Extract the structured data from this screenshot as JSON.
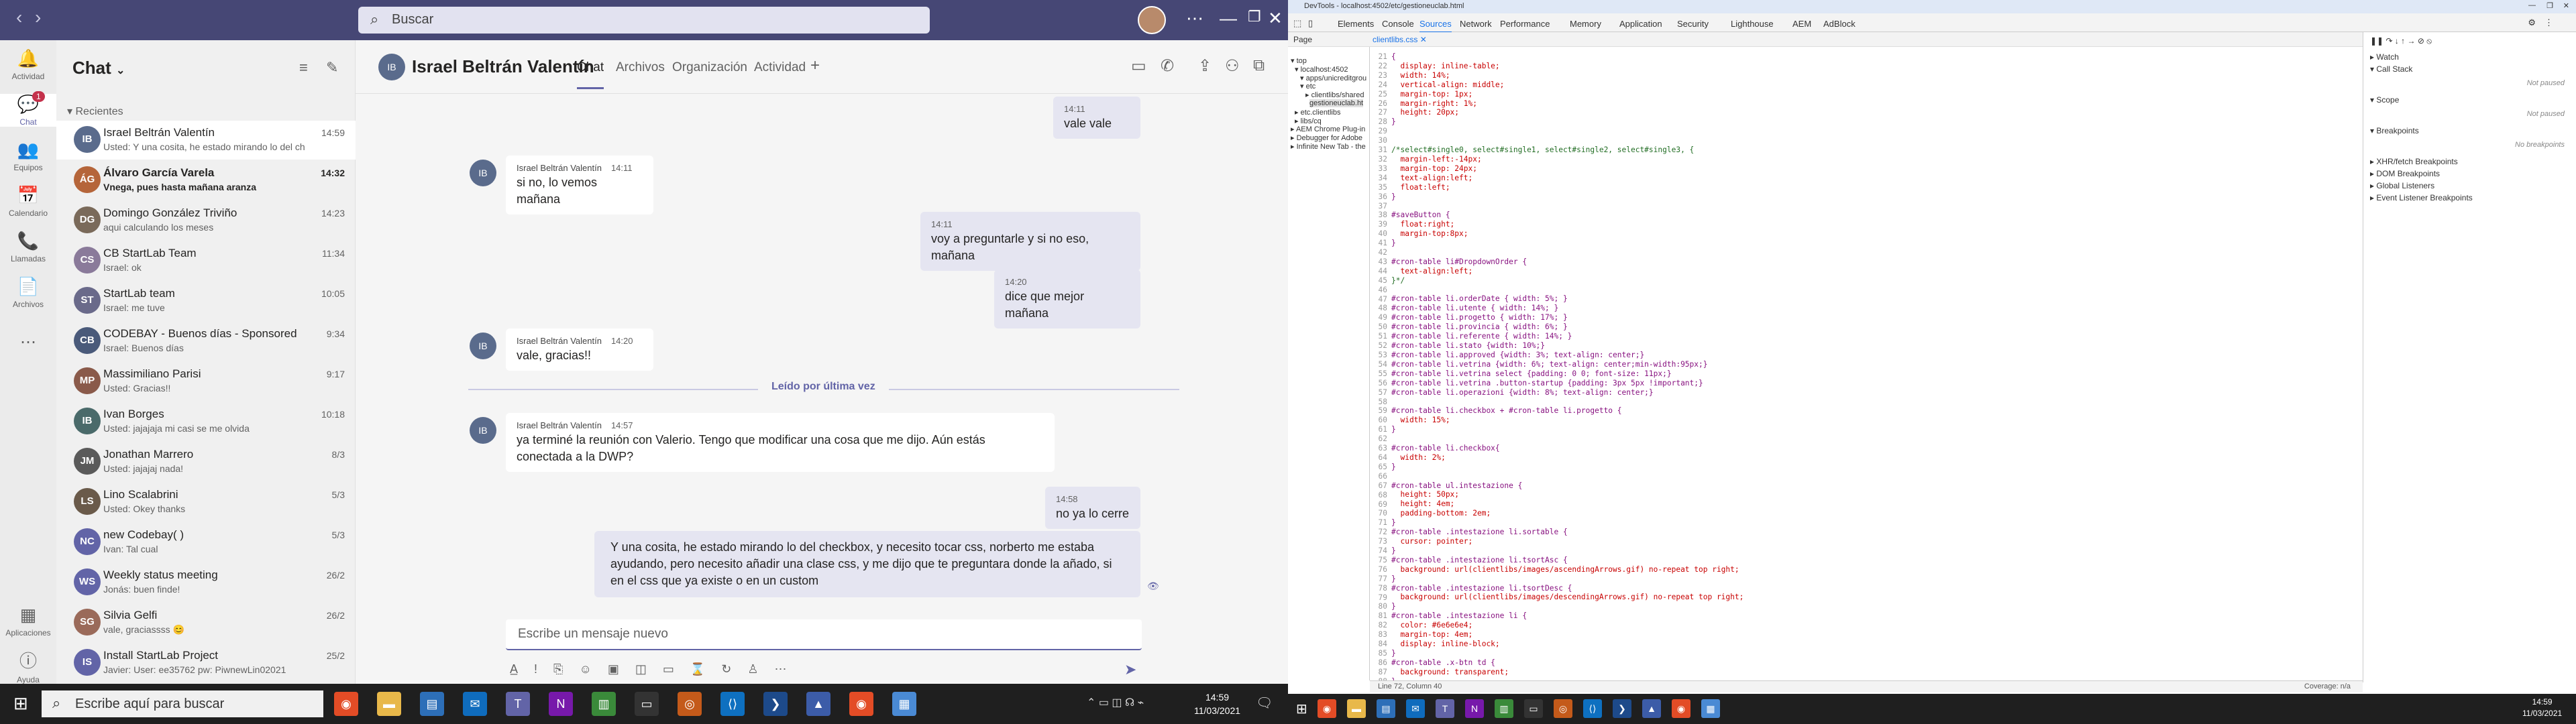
{
  "teams": {
    "search_placeholder": "Buscar",
    "rail": [
      {
        "label": "Actividad",
        "icon": "bell-icon"
      },
      {
        "label": "Chat",
        "icon": "chat-icon",
        "badge": "1"
      },
      {
        "label": "Equipos",
        "icon": "teams-icon"
      },
      {
        "label": "Calendario",
        "icon": "calendar-icon"
      },
      {
        "label": "Llamadas",
        "icon": "phone-icon"
      },
      {
        "label": "Archivos",
        "icon": "file-icon"
      },
      {
        "label": "Aplicaciones",
        "icon": "apps-icon"
      },
      {
        "label": "Ayuda",
        "icon": "help-icon"
      }
    ],
    "list_title": "Chat",
    "recent_label": "Recientes",
    "chats": [
      {
        "name": "Israel Beltrán Valentín",
        "preview": "Usted: Y una cosita, he estado mirando lo del ch...",
        "time": "14:59",
        "initials": "IB",
        "color": "#5a6b8c"
      },
      {
        "name": "Álvaro García Varela",
        "preview": "Vnega, pues hasta mañana aranza",
        "time": "14:32",
        "initials": "ÁG",
        "color": "#b5653a"
      },
      {
        "name": "Domingo González Triviño",
        "preview": "aqui calculando los meses",
        "time": "14:23",
        "initials": "DG",
        "color": "#7a6a5a"
      },
      {
        "name": "CB StartLab Team",
        "preview": "Israel: ok",
        "time": "11:34",
        "initials": "CS",
        "color": "#8a7a9a"
      },
      {
        "name": "StartLab team",
        "preview": "Israel: me tuve",
        "time": "10:05",
        "initials": "ST",
        "color": "#6a6a8a"
      },
      {
        "name": "CODEBAY - Buenos días - Sponsored by...",
        "preview": "Israel: Buenos días",
        "time": "9:34",
        "initials": "CB",
        "color": "#4a5a7a"
      },
      {
        "name": "Massimiliano Parisi",
        "preview": "Usted: Gracias!!",
        "time": "9:17",
        "initials": "MP",
        "color": "#8a5a4a"
      },
      {
        "name": "Ivan Borges",
        "preview": "Usted: jajajaja mi casi se me olvida",
        "time": "10:18",
        "initials": "IB",
        "color": "#4a6a6a"
      },
      {
        "name": "Jonathan Marrero",
        "preview": "Usted: jajajaj nada!",
        "time": "8/3",
        "initials": "JM",
        "color": "#5a5a5a"
      },
      {
        "name": "Lino Scalabrini",
        "preview": "Usted: Okey thanks",
        "time": "5/3",
        "initials": "LS",
        "color": "#6a5a4a"
      },
      {
        "name": "new Codebay( )",
        "preview": "Ivan: Tal cual",
        "time": "5/3",
        "initials": "NC",
        "color": "#6264a7"
      },
      {
        "name": "Weekly status meeting",
        "preview": "Jonás: buen finde!",
        "time": "26/2",
        "initials": "WS",
        "color": "#6264a7"
      },
      {
        "name": "Silvia Gelfi",
        "preview": "vale, graciassss 😊",
        "time": "26/2",
        "initials": "SG",
        "color": "#9a6a5a"
      },
      {
        "name": "Install StartLab Project",
        "preview": "Javier: User: ee35762 pw: PiwnewLin02021",
        "time": "25/2",
        "initials": "IS",
        "color": "#6264a7"
      }
    ],
    "conversation": {
      "name": "Israel Beltrán Valentín",
      "tabs": [
        "Chat",
        "Archivos",
        "Organización",
        "Actividad"
      ],
      "add_tab": "+",
      "read_label": "Leído por última vez",
      "compose_placeholder": "Escribe un mensaje nuevo",
      "messages": [
        {
          "who": "me",
          "time": "14:11",
          "text": "vale vale"
        },
        {
          "who": "them",
          "author": "Israel Beltrán Valentín",
          "time": "14:11",
          "text": "si no, lo vemos mañana"
        },
        {
          "who": "me",
          "time": "14:11",
          "text": "voy a preguntarle y si no eso, mañana"
        },
        {
          "who": "me",
          "time": "14:20",
          "text": "dice que mejor mañana"
        },
        {
          "who": "them",
          "author": "Israel Beltrán Valentín",
          "time": "14:20",
          "text": "vale, gracias!!"
        },
        {
          "who": "them",
          "author": "Israel Beltrán Valentín",
          "time": "14:57",
          "text": "ya terminé la reunión con Valerio. Tengo que modificar una cosa que me dijo. Aún estás conectada a la DWP?"
        },
        {
          "who": "me",
          "time": "14:58",
          "text": "no ya lo cerre"
        },
        {
          "who": "me",
          "time": "",
          "text": "Y una cosita, he estado mirando lo del checkbox, y necesito tocar css, norberto me estaba ayudando, pero necesito añadir una clase css, y me dijo que te preguntara donde la añado, si en el css que ya existe o en un custom"
        }
      ]
    },
    "taskbar": {
      "search": "Escribe aquí para buscar",
      "time": "14:59",
      "date": "11/03/2021"
    }
  },
  "devtools": {
    "title": "DevTools - localhost:4502/etc/gestioneuclab.html",
    "tabs": [
      "Elements",
      "Console",
      "Sources",
      "Network",
      "Performance",
      "Memory",
      "Application",
      "Security",
      "Lighthouse",
      "AEM",
      "AdBlock"
    ],
    "active_tab": "Sources",
    "sub_page": "Page",
    "file_tab": "clientlibs.css",
    "tree": [
      "▾ top",
      "▾ localhost:4502",
      "▾ apps/unicreditgrou",
      "▾ etc",
      "▸ clientlibs/shared",
      "gestioneuclab.ht",
      "▸ etc.clientlibs",
      "▸ libs/cq",
      "▸ AEM Chrome Plug-in",
      "▸ Debugger for Adobe",
      "▸ Infinite New Tab - the"
    ],
    "line_start": 21,
    "code_lines": [
      "{",
      "  display: inline-table;",
      "  width: 14%;",
      "  vertical-align: middle;",
      "  margin-top: 1px;",
      "  margin-right: 1%;",
      "  height: 20px;",
      "}",
      "",
      "",
      "/*select#single0, select#single1, select#single2, select#single3, {",
      "  margin-left:-14px;",
      "  margin-top: 24px;",
      "  text-align:left;",
      "  float:left;",
      "}",
      "",
      "#saveButton {",
      "  float:right;",
      "  margin-top:8px;",
      "}",
      "",
      "#cron-table li#DropdownOrder {",
      "  text-align:left;",
      "}*/",
      "",
      "#cron-table li.orderDate { width: 5%; }",
      "#cron-table li.utente { width: 14%; }",
      "#cron-table li.progetto { width: 17%; }",
      "#cron-table li.provincia { width: 6%; }",
      "#cron-table li.referente { width: 14%; }",
      "#cron-table li.stato {width: 10%;}",
      "#cron-table li.approved {width: 3%; text-align: center;}",
      "#cron-table li.vetrina {width: 6%; text-align: center;min-width:95px;}",
      "#cron-table li.vetrina select {padding: 0 0; font-size: 11px;}",
      "#cron-table li.vetrina .button-startup {padding: 3px 5px !important;}",
      "#cron-table li.operazioni {width: 8%; text-align: center;}",
      "",
      "#cron-table li.checkbox + #cron-table li.progetto {",
      "  width: 15%;",
      "}",
      "",
      "#cron-table li.checkbox{",
      "  width: 2%;",
      "}",
      "",
      "#cron-table ul.intestazione {",
      "  height: 50px;",
      "  height: 4em;",
      "  padding-bottom: 2em;",
      "}",
      "#cron-table .intestazione li.sortable {",
      "  cursor: pointer;",
      "}",
      "#cron-table .intestazione li.tsortAsc {",
      "  background: url(clientlibs/images/ascendingArrows.gif) no-repeat top right;",
      "}",
      "#cron-table .intestazione li.tsortDesc {",
      "  background: url(clientlibs/images/descendingArrows.gif) no-repeat top right;",
      "}",
      "#cron-table .intestazione li {",
      "  color: #6e6e6e4;",
      "  margin-top: 4em;",
      "  display: inline-block;",
      "}",
      "#cron-table .x-btn td {",
      "  background: transparent;",
      "}"
    ],
    "sidebar": [
      {
        "label": "▸ Watch"
      },
      {
        "label": "▾ Call Stack",
        "note": "Not paused"
      },
      {
        "label": "▾ Scope",
        "note": "Not paused"
      },
      {
        "label": "▾ Breakpoints",
        "note": "No breakpoints"
      },
      {
        "label": "▸ XHR/fetch Breakpoints"
      },
      {
        "label": "▸ DOM Breakpoints"
      },
      {
        "label": "▸ Global Listeners"
      },
      {
        "label": "▸ Event Listener Breakpoints"
      }
    ],
    "status": "Line 72, Column 40",
    "coverage": "Coverage: n/a",
    "taskbar_time": "14:59",
    "taskbar_date": "11/03/2021"
  }
}
